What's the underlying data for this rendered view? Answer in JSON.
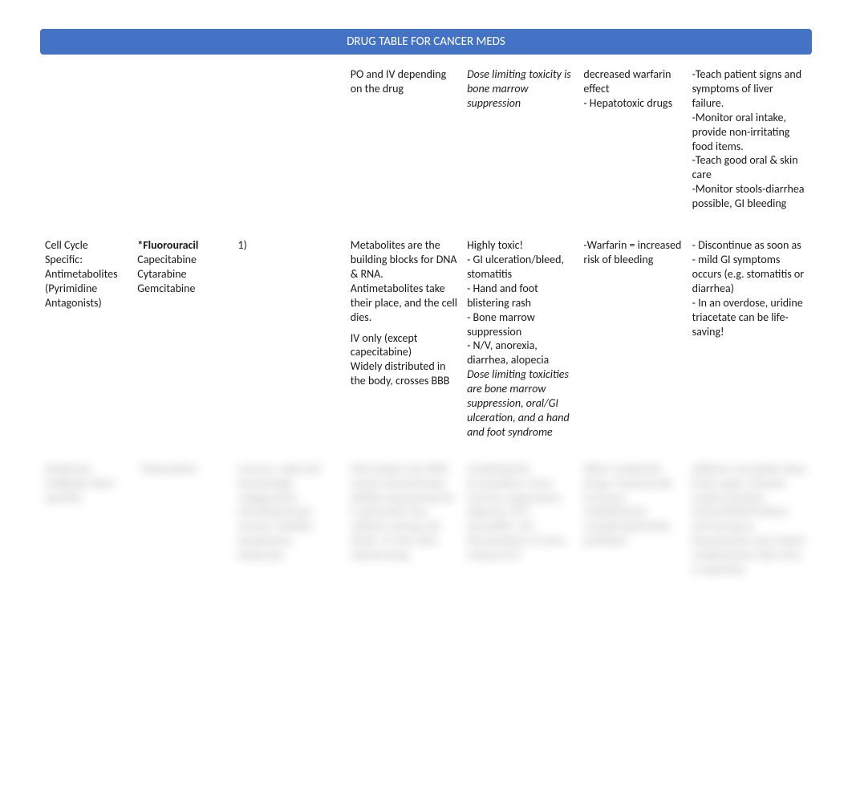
{
  "title": "DRUG TABLE FOR CANCER MEDS",
  "row1": {
    "c4": "PO and IV depending on the drug",
    "c5": "Dose limiting toxicity is bone marrow suppression",
    "c6_a": "decreased warfarin effect",
    "c6_b": "- Hepatotoxic drugs",
    "c7_a": "-Teach patient signs and symptoms of liver failure.",
    "c7_b": "-Monitor oral intake, provide non-irritating food items.",
    "c7_c": "-Teach good oral & skin care",
    "c7_d": "-Monitor stools-diarrhea possible, GI bleeding"
  },
  "row2": {
    "c1": "Cell Cycle Specific: Antimetabolites (Pyrimidine Antagonists)",
    "c2_a": "*Fluorouracil",
    "c2_b": "Capecitabine",
    "c2_c": "Cytarabine",
    "c2_d": "Gemcitabine",
    "c3": "1)",
    "c4_a": "Metabolites are the building blocks for DNA & RNA. Antimetabolites take their place, and the cell dies.",
    "c4_b": "IV only (except capecitabine)",
    "c4_c": "Widely distributed in the body, crosses BBB",
    "c5_a": "Highly toxic!",
    "c5_b": "- GI ulceration/bleed, stomatitis",
    "c5_c": "- Hand and foot blistering rash",
    "c5_d": "- Bone marrow suppression",
    "c5_e": "- N/V, anorexia, diarrhea, alopecia",
    "c5_f": "Dose limiting toxicities are bone marrow suppression, oral/GI ulceration, and a hand and foot syndrome",
    "c6": "-Warfarin = increased risk of bleeding",
    "c7_a": "- Discontinue as soon as",
    "c7_b": "- mild GI symptoms occurs (e.g. stomatitis or diarrhea)",
    "c7_c": "- In an overdose, uridine triacetate can be life-saving!"
  },
  "row3": {
    "c1": "Antitumor Antibiotic (Non-specific)",
    "c2": "*Doxorubicin",
    "c3": "Cancers: solid and hematologic malignancies including breast, ovarian, bladder, lymphomas, leukemias",
    "c4": "Intercalates into DNA, causes strand breaks, inhibits topoisomerase II; generates free radicals causing cell death. IV only. Red-colored drug.",
    "c5": "Cardiotoxicity (cumulative), bone marrow suppression, alopecia, N/V, stomatitis, red discoloration of urine, vesicant D/I",
    "c6": "Other cardiotoxic drugs; trastuzumab increases cardiotoxicity; cyclophosphamide, paclitaxel",
    "c7": "Lifetime cumulative dose limits apply. Monitor cardiac function (echo/MUGA) before and during tx. Dexrazoxane may reduce cardiotoxicity. Red urine is expected."
  }
}
